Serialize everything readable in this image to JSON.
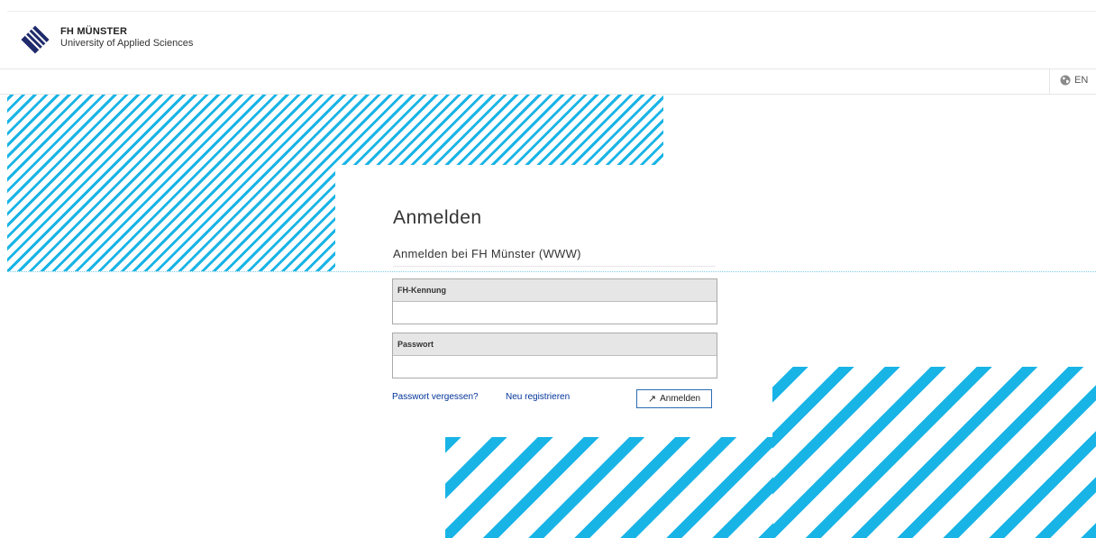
{
  "header": {
    "brand_name": "FH MÜNSTER",
    "brand_subtitle": "University of Applied Sciences",
    "logo_icon": "fh-muenster-logo-icon"
  },
  "language": {
    "label": "EN",
    "icon": "globe-icon"
  },
  "login": {
    "title": "Anmelden",
    "subtitle": "Anmelden bei FH Münster (WWW)",
    "username_label": "FH-Kennung",
    "username_value": "",
    "password_label": "Passwort",
    "password_value": "",
    "forgot_password": "Passwort vergessen?",
    "register": "Neu registrieren",
    "submit_label": "Anmelden",
    "submit_icon": "arrow-up-right-icon"
  },
  "colors": {
    "accent": "#19b4e6",
    "link": "#003399",
    "button_border": "#2a6db5"
  }
}
